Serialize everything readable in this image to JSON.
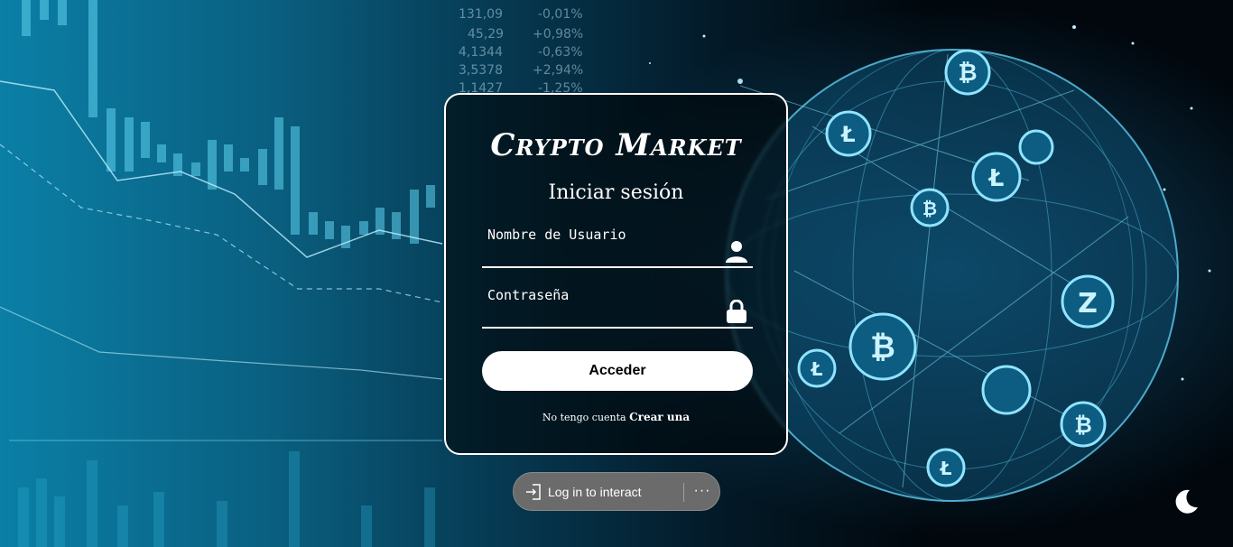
{
  "login": {
    "brand": "Crypto Market",
    "heading": "Iniciar sesión",
    "username_label": "Nombre de Usuario",
    "password_label": "Contraseña",
    "submit_label": "Acceder",
    "no_account_text": "No tengo cuenta",
    "signup_link": "Crear una"
  },
  "overlay": {
    "login_to_interact": "Log in to interact",
    "more_label": "···"
  },
  "background_ticker": {
    "rows": [
      {
        "value": "131,09",
        "change": "-0,01%"
      },
      {
        "value": "45,29",
        "change": "+0,98%"
      },
      {
        "value": "4,1344",
        "change": "-0,63%"
      },
      {
        "value": "3,5378",
        "change": "+2,94%"
      },
      {
        "value": "1,1427",
        "change": "-1,25%"
      }
    ]
  },
  "icons": {
    "user": "user-icon",
    "lock": "lock-icon",
    "login": "login-icon",
    "theme": "moon-icon"
  },
  "colors": {
    "accent": "#0a8fb8",
    "card_border": "#ffffff",
    "button_bg": "#ffffff"
  }
}
